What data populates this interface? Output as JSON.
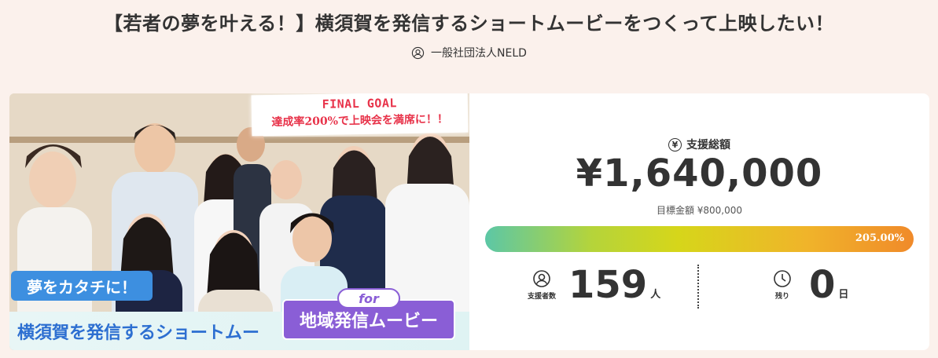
{
  "title": "【若者の夢を叶える！】横須賀を発信するショートムービーをつくって上映したい！",
  "owner": {
    "icon": "user-circle-icon",
    "name": "一般社団法人NELD"
  },
  "hero": {
    "goal_title": "FINAL GOAL",
    "goal_sub": "達成率200%で上映会を満席に！！",
    "tag_dream": "夢をカタチに！",
    "tag_yokosuka": "横須賀を発信するショートムー",
    "tag_for": "for",
    "tag_movie": "地域発信ムービー"
  },
  "stats": {
    "support_label": "支援総額",
    "yen_icon": "yen-circle-icon",
    "amount": "¥1,640,000",
    "target": "目標金額 ¥800,000",
    "progress_text": "205.00%",
    "progress_ratio": 2.05,
    "supporters_label": "支援者数",
    "supporters_icon": "user-circle-icon",
    "supporters": "159",
    "supporters_unit": "人",
    "remaining_label": "残り",
    "remaining_icon": "clock-icon",
    "remaining": "0",
    "remaining_unit": "日"
  },
  "colors": {
    "background": "#fbf1ec",
    "accent_blue": "#3d8fe0",
    "accent_purple": "#8a5ed6",
    "goal_red": "#e8334a"
  }
}
